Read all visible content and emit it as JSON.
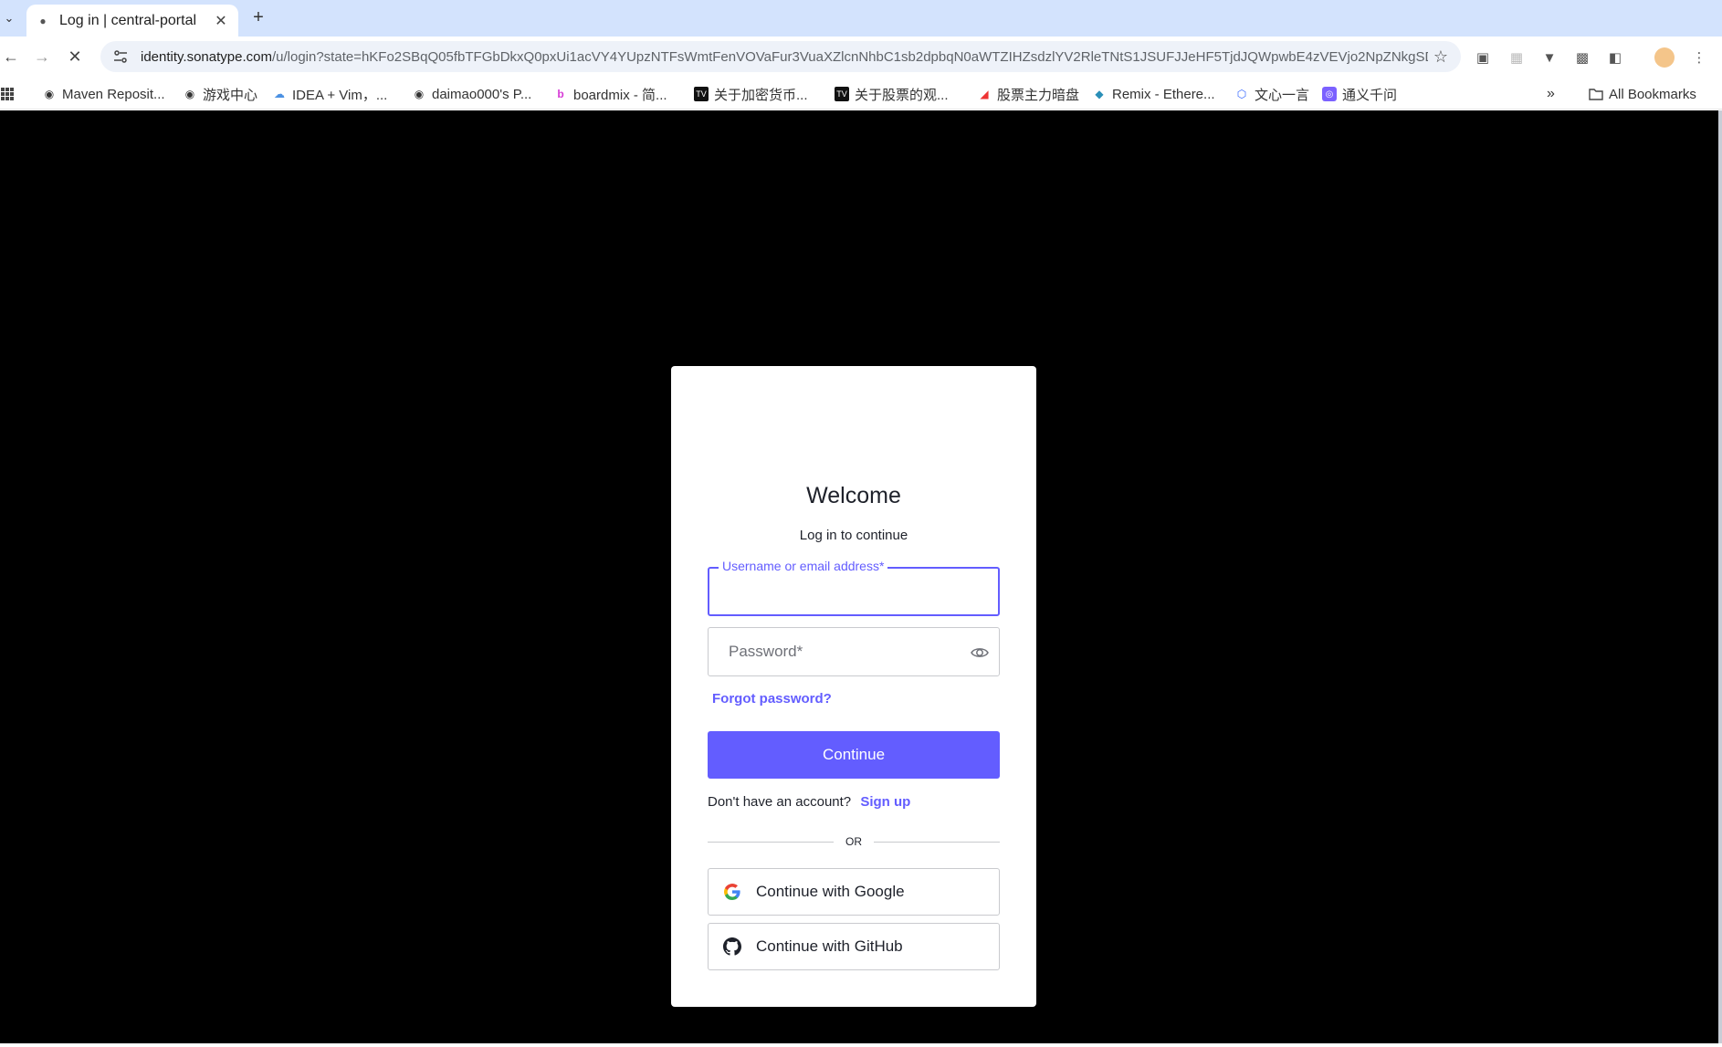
{
  "browser": {
    "tab": {
      "title": "Log in | central-portal"
    },
    "url": {
      "host": "identity.sonatype.com",
      "path": "/u/login?state=hKFo2SBqQ05fbTFGbDkxQ0pxUi1acVY4YUpzNTFsWmtFenVOVaFur3VuaXZlcnNhbC1sb2dpbqN0aWTZIHZsdzlYV2RleTNtS1JSUFJJeHF5TjdJQWpwbE4zVEVjo2NpZNkgSDZ..."
    },
    "bookmarks": [
      {
        "label": "Maven Reposit...",
        "icon": "globe-icon"
      },
      {
        "label": "游戏中心",
        "icon": "globe-icon"
      },
      {
        "label": "IDEA + Vim，...",
        "icon": "cloud-icon"
      },
      {
        "label": "daimao000's P...",
        "icon": "github-icon"
      },
      {
        "label": "boardmix - 简...",
        "icon": "boardmix-icon"
      },
      {
        "label": "关于加密货币...",
        "icon": "tv-icon"
      },
      {
        "label": "关于股票的观...",
        "icon": "tv-icon"
      },
      {
        "label": "股票主力暗盘",
        "icon": "chart-icon"
      },
      {
        "label": "Remix - Ethere...",
        "icon": "remix-icon"
      },
      {
        "label": "文心一言",
        "icon": "cube-icon"
      },
      {
        "label": "通义千问",
        "icon": "tongyi-icon"
      }
    ],
    "all_bookmarks": "All Bookmarks",
    "overflow": "»"
  },
  "login": {
    "title": "Welcome",
    "subtitle": "Log in to continue",
    "username_label": "Username or email address*",
    "username_value": "",
    "password_placeholder": "Password*",
    "forgot": "Forgot password?",
    "continue": "Continue",
    "no_account": "Don't have an account?",
    "signup": "Sign up",
    "or": "OR",
    "google": "Continue with Google",
    "github": "Continue with GitHub"
  },
  "colors": {
    "accent": "#635dff",
    "page_background": "#000000",
    "tabstrip": "#d3e3fd"
  }
}
